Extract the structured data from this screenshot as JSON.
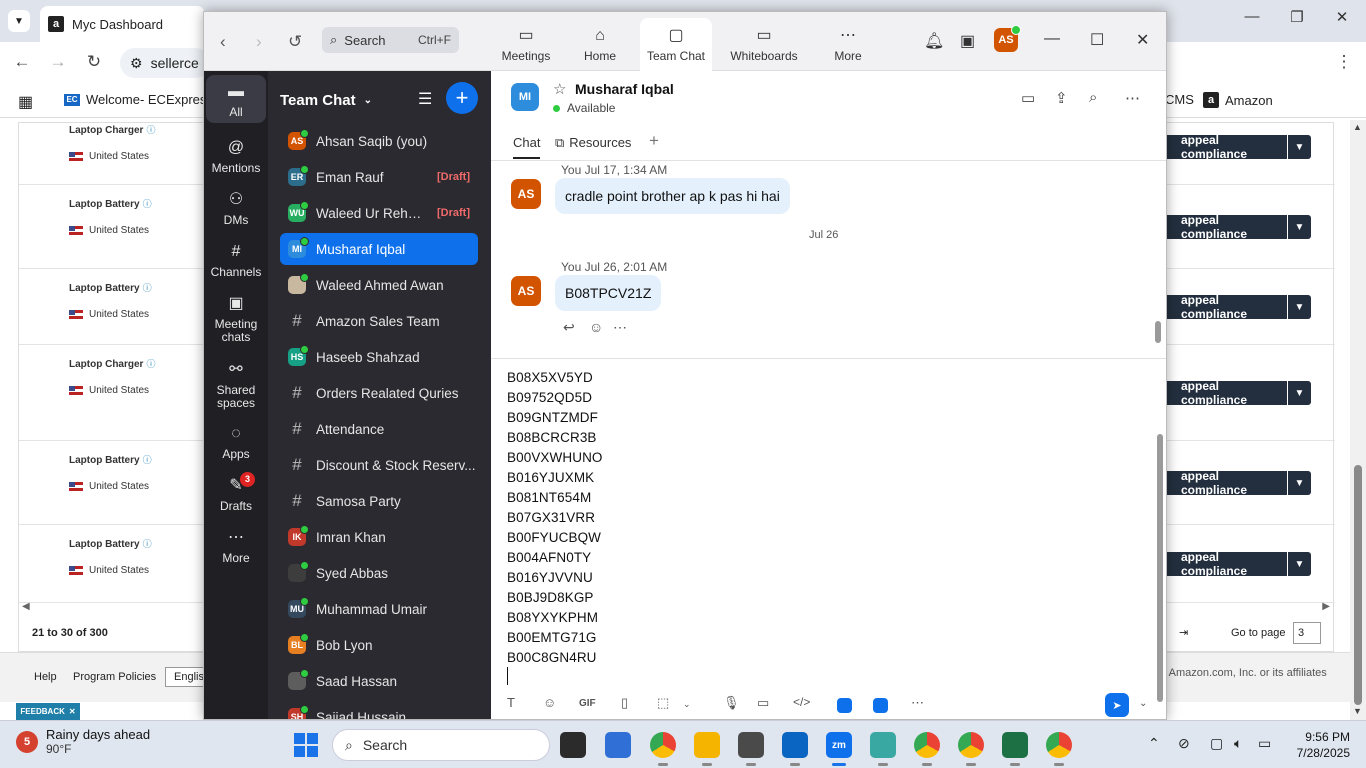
{
  "browser": {
    "tab_title": "Myc Dashboard",
    "address_partial": "sellerce",
    "bookmarks": [
      "Welcome- ECExpres...",
      "CMS",
      "Amazon"
    ],
    "rows": [
      {
        "product": "Laptop Charger",
        "location": "United States",
        "action": "appeal compliance"
      },
      {
        "product": "Laptop Battery",
        "location": "United States",
        "action": "appeal compliance"
      },
      {
        "product": "Laptop Battery",
        "location": "United States",
        "action": "appeal compliance"
      },
      {
        "product": "Laptop Charger",
        "location": "United States",
        "action": "appeal compliance"
      },
      {
        "product": "Laptop Battery",
        "location": "United States",
        "action": "appeal compliance"
      },
      {
        "product": "Laptop Battery",
        "location": "United States",
        "action": "appeal compliance"
      }
    ],
    "pagination": {
      "range": "21 to 30 of 300",
      "goto_label": "Go to page",
      "page_value": "3"
    },
    "footer": {
      "help": "Help",
      "policies": "Program Policies",
      "language": "English",
      "copyright": "©, Amazon.com, Inc. or its affiliates"
    },
    "feedback": "FEEDBACK"
  },
  "zoom": {
    "search": {
      "label": "Search",
      "shortcut": "Ctrl+F"
    },
    "main_tabs": [
      {
        "label": "Meetings",
        "icon": "video-camera-icon"
      },
      {
        "label": "Home",
        "icon": "home-icon"
      },
      {
        "label": "Team Chat",
        "icon": "chat-icon"
      },
      {
        "label": "Whiteboards",
        "icon": "whiteboard-icon"
      },
      {
        "label": "More",
        "icon": "more-icon"
      }
    ],
    "user_initials": "AS",
    "rail": [
      {
        "label": "All",
        "icon": "chat-bubble-icon"
      },
      {
        "label": "Mentions",
        "icon": "at-icon"
      },
      {
        "label": "DMs",
        "icon": "people-icon"
      },
      {
        "label": "Channels",
        "icon": "hash-icon"
      },
      {
        "label": "Meeting chats",
        "icon": "calendar-icon"
      },
      {
        "label": "Shared spaces",
        "icon": "shared-spaces-icon"
      },
      {
        "label": "Apps",
        "icon": "apps-icon"
      },
      {
        "label": "Drafts",
        "icon": "drafts-icon",
        "badge": "3"
      },
      {
        "label": "More",
        "icon": "more-icon"
      }
    ],
    "list_title": "Team Chat",
    "chats": [
      {
        "name": "Ahsan Saqib (you)",
        "initials": "AS",
        "color": "#d35400",
        "type": "person"
      },
      {
        "name": "Eman Rauf",
        "initials": "ER",
        "color": "#2d6d8c",
        "type": "person",
        "draft": "[Draft]"
      },
      {
        "name": "Waleed Ur Rehm...",
        "initials": "WU",
        "color": "#27ae60",
        "type": "person",
        "draft": "[Draft]"
      },
      {
        "name": "Musharaf Iqbal",
        "initials": "MI",
        "color": "#2d8cdc",
        "type": "person",
        "active": true
      },
      {
        "name": "Waleed Ahmed Awan",
        "initials": "",
        "color": "#c9b8a0",
        "type": "person"
      },
      {
        "name": "Amazon Sales Team",
        "type": "channel"
      },
      {
        "name": "Haseeb Shahzad",
        "initials": "HS",
        "color": "#16a085",
        "type": "person"
      },
      {
        "name": "Orders Realated Quries",
        "type": "channel"
      },
      {
        "name": "Attendance",
        "type": "channel"
      },
      {
        "name": "Discount & Stock Reserv...",
        "type": "channel"
      },
      {
        "name": "Samosa Party",
        "type": "channel"
      },
      {
        "name": "Imran Khan",
        "initials": "IK",
        "color": "#c0392b",
        "type": "person"
      },
      {
        "name": "Syed Abbas",
        "initials": "",
        "color": "#3d3d3d",
        "type": "person"
      },
      {
        "name": "Muhammad Umair",
        "initials": "MU",
        "color": "#34495e",
        "type": "person"
      },
      {
        "name": "Bob Lyon",
        "initials": "BL",
        "color": "#e67e22",
        "type": "person"
      },
      {
        "name": "Saad Hassan",
        "initials": "",
        "color": "#5d5d5d",
        "type": "person"
      },
      {
        "name": "Sajjad Hussain",
        "initials": "SH",
        "color": "#c0392b",
        "type": "person"
      }
    ],
    "conversation": {
      "name": "Musharaf Iqbal",
      "initials": "MI",
      "status": "Available",
      "tabs": [
        "Chat",
        "Resources"
      ],
      "messages": [
        {
          "meta": "You Jul 17, 1:34 AM",
          "text": "cradle point brother ap k pas hi hai",
          "initials": "AS"
        },
        {
          "meta": "You Jul 26, 2:01 AM",
          "text": "B08TPCV21Z",
          "initials": "AS"
        }
      ],
      "date_separator": "Jul 26",
      "composer_lines": [
        "B08X5XV5YD",
        "B09752QD5D",
        "B09GNTZMDF",
        "B08BCRCR3B",
        "B00VXWHUNO",
        "B016YJUXMK",
        "B081NT654M",
        "B07GX31VRR",
        "B00FYUCBQW",
        "B004AFN0TY",
        "B016YJVVNU",
        "B0BJ9D8KGP",
        "B08YXYKPHM",
        "B00EMTG71G",
        "B00C8GN4RU"
      ]
    }
  },
  "taskbar": {
    "weather_badge": "5",
    "weather_title": "Rainy days ahead",
    "weather_temp": "90°F",
    "search": "Search",
    "time": "9:56 PM",
    "date": "7/28/2025"
  }
}
